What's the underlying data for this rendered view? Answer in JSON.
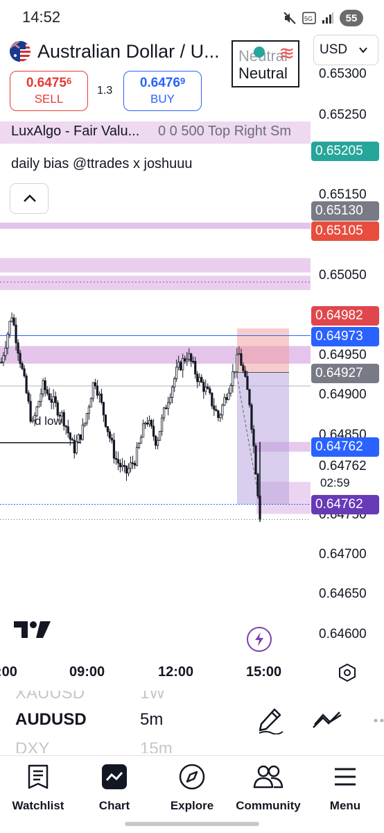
{
  "status_bar": {
    "time": "14:52",
    "battery": "55",
    "icons": [
      "mute-icon",
      "5g-signal-icon",
      "signal-bars-icon",
      "battery-icon"
    ]
  },
  "header": {
    "symbol_title": "Australian Dollar / U...",
    "currency": "USD",
    "flags": [
      "australia-flag",
      "usa-flag"
    ],
    "sentiment": {
      "ghost": "Neutral",
      "label": "Neutral"
    }
  },
  "trade": {
    "sell_price_main": "0.6475",
    "sell_price_sup": "6",
    "sell_label": "SELL",
    "spread": "1.3",
    "buy_price_main": "0.6476",
    "buy_price_sup": "9",
    "buy_label": "BUY"
  },
  "indicators": {
    "first_name": "LuxAlgo - Fair Valu...",
    "first_params": "0 0 500 Top Right Sm",
    "second_name": "daily bias @ttrades x joshuuu"
  },
  "chart_annotations": {
    "level_label": "d low",
    "countdown": "02:59"
  },
  "price_axis": {
    "ticks": [
      "0.65300",
      "0.65250",
      "0.65150",
      "0.65050",
      "0.64950",
      "0.64900",
      "0.64850",
      "0.64762",
      "0.64750",
      "0.64700",
      "0.64650",
      "0.64600"
    ],
    "badges": [
      {
        "value": "0.65205",
        "color": "#26a69a"
      },
      {
        "value": "0.65130",
        "color": "#787b86"
      },
      {
        "value": "0.65105",
        "color": "#e84e3d"
      },
      {
        "value": "0.64982",
        "color": "#e0474c"
      },
      {
        "value": "0.64973",
        "color": "#2962ff"
      },
      {
        "value": "0.64927",
        "color": "#787b86"
      },
      {
        "value": "0.64762",
        "color": "#2962ff"
      },
      {
        "value": "0.64762",
        "color": "#673ab7"
      }
    ]
  },
  "time_axis": {
    "labels": [
      ":00",
      "09:00",
      "12:00",
      "15:00"
    ]
  },
  "symbol_picker": {
    "above": {
      "symbol": "XAUUSD",
      "timeframe": "1W"
    },
    "current": {
      "symbol": "AUDUSD",
      "timeframe": "5m"
    },
    "below": {
      "symbol": "DXY",
      "timeframe": "15m"
    }
  },
  "bottom_nav": {
    "items": [
      {
        "label": "Watchlist",
        "icon": "watchlist-icon"
      },
      {
        "label": "Chart",
        "icon": "chart-icon"
      },
      {
        "label": "Explore",
        "icon": "compass-icon"
      },
      {
        "label": "Community",
        "icon": "community-icon"
      },
      {
        "label": "Menu",
        "icon": "menu-icon"
      }
    ]
  },
  "colors": {
    "up": "#131722",
    "fvg_zone": "#ce93d8",
    "stop_zone": "#ef9a9a",
    "target_zone": "#b39ddb",
    "accent_purple": "#7b3fb0"
  },
  "chart_data": {
    "type": "candlestick",
    "symbol": "AUDUSD",
    "timeframe": "5m",
    "y_range": [
      0.6459,
      0.6532
    ],
    "x_labels": [
      ":00",
      "09:00",
      "12:00",
      "15:00"
    ],
    "approx_path": [
      0.6494,
      0.65,
      0.6493,
      0.6486,
      0.6491,
      0.6489,
      0.6487,
      0.6483,
      0.6486,
      0.6492,
      0.6487,
      0.6482,
      0.648,
      0.6482,
      0.6487,
      0.6484,
      0.6489,
      0.6493,
      0.6495,
      0.6492,
      0.649,
      0.6487,
      0.6491,
      0.6495,
      0.6489,
      0.6475
    ],
    "last_price": 0.64762
  }
}
